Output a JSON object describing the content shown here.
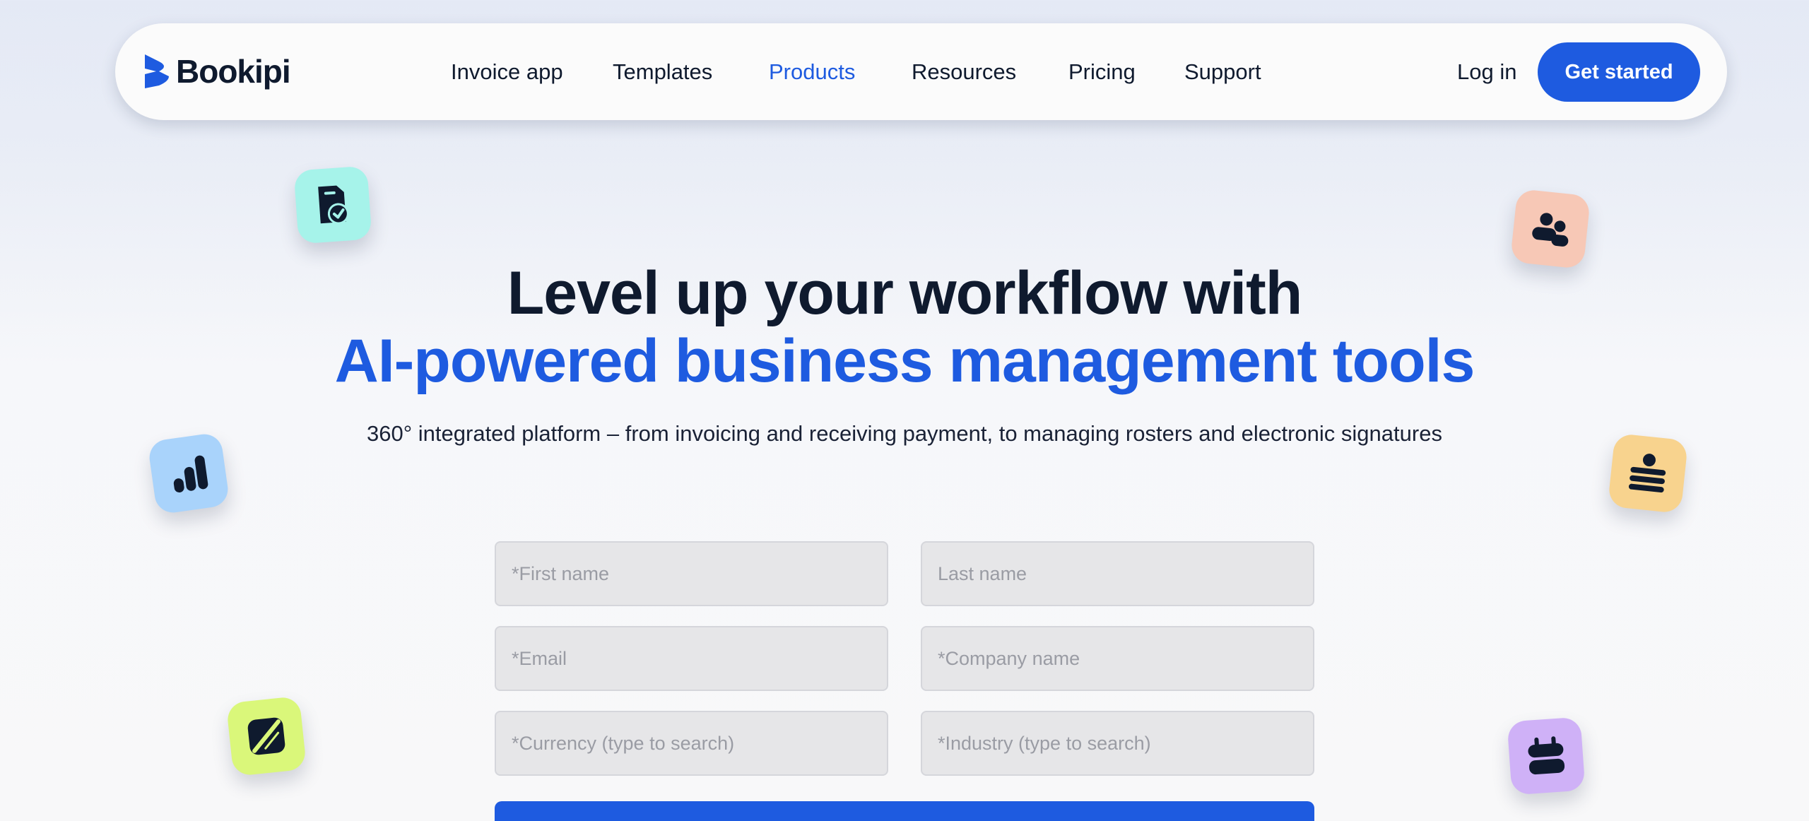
{
  "brand": {
    "name": "Bookipi",
    "accent": "#1e5be0",
    "dark": "#0f1a2e"
  },
  "nav": {
    "items": [
      {
        "label": "Invoice app"
      },
      {
        "label": "Templates"
      },
      {
        "label": "Products",
        "active": true
      },
      {
        "label": "Resources"
      },
      {
        "label": "Pricing"
      },
      {
        "label": "Support"
      }
    ],
    "login": "Log in",
    "cta": "Get started"
  },
  "hero": {
    "line1": "Level up your workflow with",
    "line2": "AI-powered business management tools",
    "subtitle": "360° integrated platform – from invoicing and receiving payment, to managing rosters and electronic signatures"
  },
  "form": {
    "first_name": "*First name",
    "last_name": "Last name",
    "email": "*Email",
    "company": "*Company name",
    "currency": "*Currency (type to search)",
    "industry": "*Industry (type to search)"
  },
  "floating_icons": [
    {
      "name": "document-check-icon",
      "color": "#a6f3ea"
    },
    {
      "name": "bar-chart-icon",
      "color": "#a9d3fb"
    },
    {
      "name": "signature-pen-icon",
      "color": "#daf77a"
    },
    {
      "name": "team-users-icon",
      "color": "#f7c8b6"
    },
    {
      "name": "money-stack-icon",
      "color": "#f8d38e"
    },
    {
      "name": "calendar-icon",
      "color": "#cfb1f7"
    }
  ]
}
